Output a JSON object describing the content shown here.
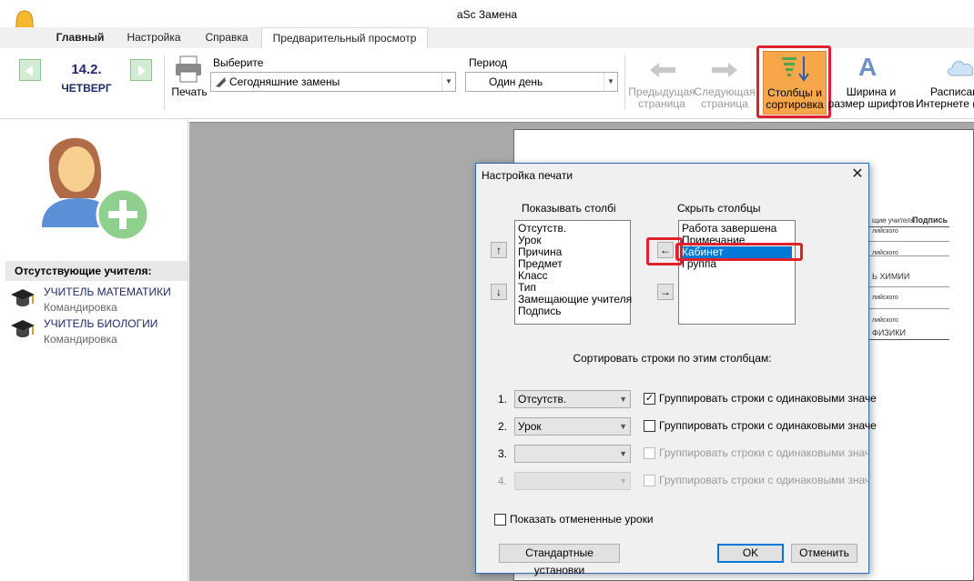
{
  "app": {
    "title": "aSc Замена"
  },
  "tabs": [
    "Главный",
    "Настройка",
    "Справка",
    "Предварительный просмотр"
  ],
  "ribbon": {
    "date": "14.2.",
    "weekday": "ЧЕТВЕРГ",
    "print_label": "Печать",
    "select_label": "Выберите",
    "select_value": "Сегодняшние замены",
    "period_label": "Период",
    "period_value": "Один день",
    "prev_page": [
      "Предыдущая",
      "страница"
    ],
    "next_page": [
      "Следующая",
      "страница"
    ],
    "columns_sort": [
      "Столбцы и",
      "сортировка"
    ],
    "font_size": [
      "Ширина и",
      "размер шрифтов"
    ],
    "schedule_web": [
      "Расписан",
      "Интернете ("
    ]
  },
  "left": {
    "absent_header": "Отсутствующие учителя:",
    "teachers": [
      {
        "name": "УЧИТЕЛЬ МАТЕМАТИКИ",
        "reason": "Командировка"
      },
      {
        "name": "УЧИТЕЛЬ БИОЛОГИИ",
        "reason": "Командировка"
      }
    ]
  },
  "paper": {
    "col_teacher": "щие учителя",
    "col_sign": "Подпись",
    "rows": [
      "лийского",
      "лийского",
      "Ь ХИМИИ",
      "лийского",
      "лийского",
      "ФИЗИКИ"
    ]
  },
  "dialog": {
    "title": "Настройка печати",
    "show_label": "Показывать столбі",
    "hide_label": "Скрыть столбцы",
    "show_items": [
      "Отсутств.",
      "Урок",
      "Причина",
      "Предмет",
      "Класс",
      "Тип",
      "Замещающие учителя",
      "Подпись"
    ],
    "hide_items": [
      "Работа завершена",
      "Примечание",
      "Кабинет",
      "Группа"
    ],
    "sort_label": "Сортировать строки по этим столбцам:",
    "sort_rows": [
      {
        "num": "1.",
        "value": "Отсутств.",
        "checked": "✓",
        "group": "Группировать строки с одинаковыми значе"
      },
      {
        "num": "2.",
        "value": "Урок",
        "checked": "",
        "group": "Группировать строки с одинаковыми значе"
      },
      {
        "num": "3.",
        "value": "",
        "checked": "",
        "group": "Группировать строки с одинаковыми значени"
      },
      {
        "num": "4.",
        "value": "",
        "checked": "",
        "group": "Группировать строки с одинаковыми значени"
      }
    ],
    "show_cancelled": "Показать отмененные уроки",
    "defaults_btn": "Стандартные установки",
    "ok_btn": "OK",
    "cancel_btn": "Отменить",
    "close": "✕",
    "arrow_up": "↑",
    "arrow_down": "↓",
    "arrow_left": "←",
    "arrow_right": "→"
  },
  "colors": {
    "accent": "#0078d7",
    "highlight": "#e0202a",
    "ribbon_active": "#f7a64a"
  }
}
